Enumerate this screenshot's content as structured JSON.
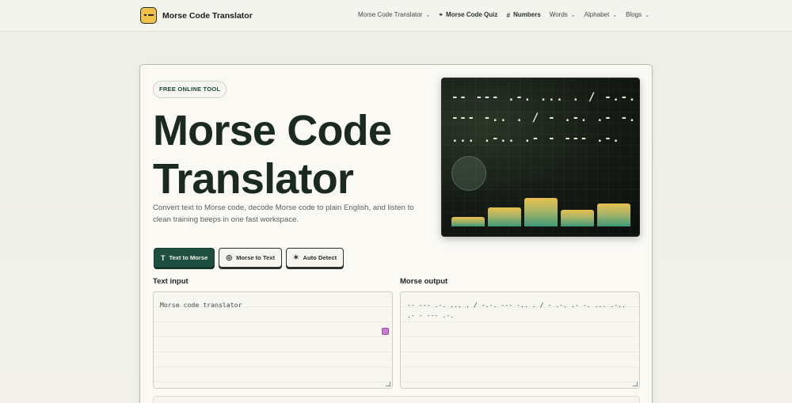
{
  "nav": {
    "brand": "Morse Code Translator",
    "items": [
      {
        "label": "Morse Code Translator",
        "chevron": true,
        "icon": "",
        "bold": false
      },
      {
        "label": "Morse Code Quiz",
        "chevron": false,
        "icon": "gamepad-icon",
        "bold": true
      },
      {
        "label": "Numbers",
        "chevron": false,
        "icon": "hash-icon",
        "bold": true
      },
      {
        "label": "Words",
        "chevron": true,
        "icon": "",
        "bold": false
      },
      {
        "label": "Alphabet",
        "chevron": true,
        "icon": "",
        "bold": false
      },
      {
        "label": "Blogs",
        "chevron": true,
        "icon": "",
        "bold": false
      }
    ]
  },
  "hero": {
    "badge": "FREE ONLINE TOOL",
    "title": "Morse Code Translator",
    "subtitle": "Convert text to Morse code, decode Morse code to plain English, and listen to clean training beeps in one fast workspace."
  },
  "modes": [
    {
      "label": "Text to Morse",
      "icon": "text-icon",
      "active": true
    },
    {
      "label": "Morse to Text",
      "icon": "signal-icon",
      "active": false
    },
    {
      "label": "Auto Detect",
      "icon": "wand-icon",
      "active": false
    }
  ],
  "input": {
    "label": "Text input",
    "value": "Morse code translator"
  },
  "output": {
    "label": "Morse output",
    "value": "-- --- .-. ... . / -.-. --- -.. . / - .-. .- -. ... .-.. .- - --- .-."
  },
  "preview": {
    "lines": [
      "-- --- .-. ... . / -.-.",
      "--- -.. . / - .-. .- -.",
      "... .-.. .- - --- .-."
    ],
    "levels": [
      0.33,
      0.68,
      1.0,
      0.58,
      0.8
    ]
  },
  "colors": {
    "accent": "#1e4f41",
    "brand_yellow": "#f0c24a",
    "bar_top": "#e7c04f",
    "bar_bottom": "#3f9878"
  }
}
